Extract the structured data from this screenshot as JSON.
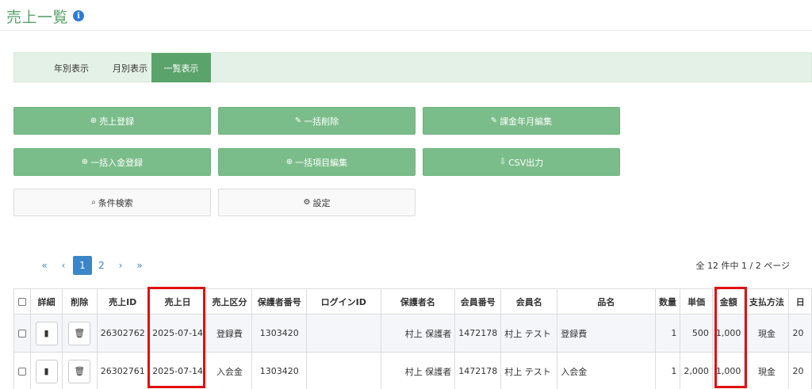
{
  "header": {
    "title": "売上一覧",
    "info_icon": "i"
  },
  "tabs": [
    {
      "label": "年別表示"
    },
    {
      "label": "月別表示"
    },
    {
      "label": "一覧表示",
      "active": true
    }
  ],
  "buttons": {
    "sales_register": {
      "icon": "⊕",
      "label": "売上登録"
    },
    "bulk_delete": {
      "icon": "✎",
      "label": "一括削除"
    },
    "billing_month_edit": {
      "icon": "✎",
      "label": "課金年月編集"
    },
    "bulk_deposit": {
      "icon": "⊕",
      "label": "一括入金登録"
    },
    "bulk_item_edit": {
      "icon": "⊕",
      "label": "一括項目編集"
    },
    "csv_export": {
      "icon": "⇩",
      "label": "CSV出力"
    },
    "search": {
      "icon": "⌕",
      "label": "条件検索"
    },
    "settings": {
      "icon": "⚙",
      "label": "設定"
    }
  },
  "pagination": {
    "first": "«",
    "prev": "‹",
    "pages": [
      "1",
      "2"
    ],
    "next": "›",
    "last": "»",
    "summary": "全 12 件中 1 / 2 ページ"
  },
  "table": {
    "headers": [
      "詳細",
      "削除",
      "売上ID",
      "売上日",
      "売上区分",
      "保護者番号",
      "ログインID",
      "保護者名",
      "会員番号",
      "会員名",
      "品名",
      "数量",
      "単価",
      "金額",
      "支払方法",
      "日"
    ],
    "rows": [
      {
        "id": "26302762",
        "date": "2025-07-14",
        "category": "登録費",
        "guardian_no": "1303420",
        "login_id": "",
        "guardian_name": "村上 保護者",
        "member_no": "1472178",
        "member_name": "村上 テスト",
        "item": "登録費",
        "qty": "1",
        "unit_price": "500",
        "amount": "1,000",
        "payment": "現金",
        "extra": "20"
      },
      {
        "id": "26302761",
        "date": "2025-07-14",
        "category": "入会金",
        "guardian_no": "1303420",
        "login_id": "",
        "guardian_name": "村上 保護者",
        "member_no": "1472178",
        "member_name": "村上 テスト",
        "item": "入会金",
        "qty": "1",
        "unit_price": "2,000",
        "amount": "1,000",
        "payment": "現金",
        "extra": "20"
      }
    ]
  },
  "icons": {
    "detail": "file-icon",
    "delete": "trash-icon"
  },
  "colors": {
    "title_green": "#5aa36a",
    "button_green": "#7bbd8a",
    "highlight_red": "#e01010",
    "pager_blue": "#3a86c8"
  }
}
